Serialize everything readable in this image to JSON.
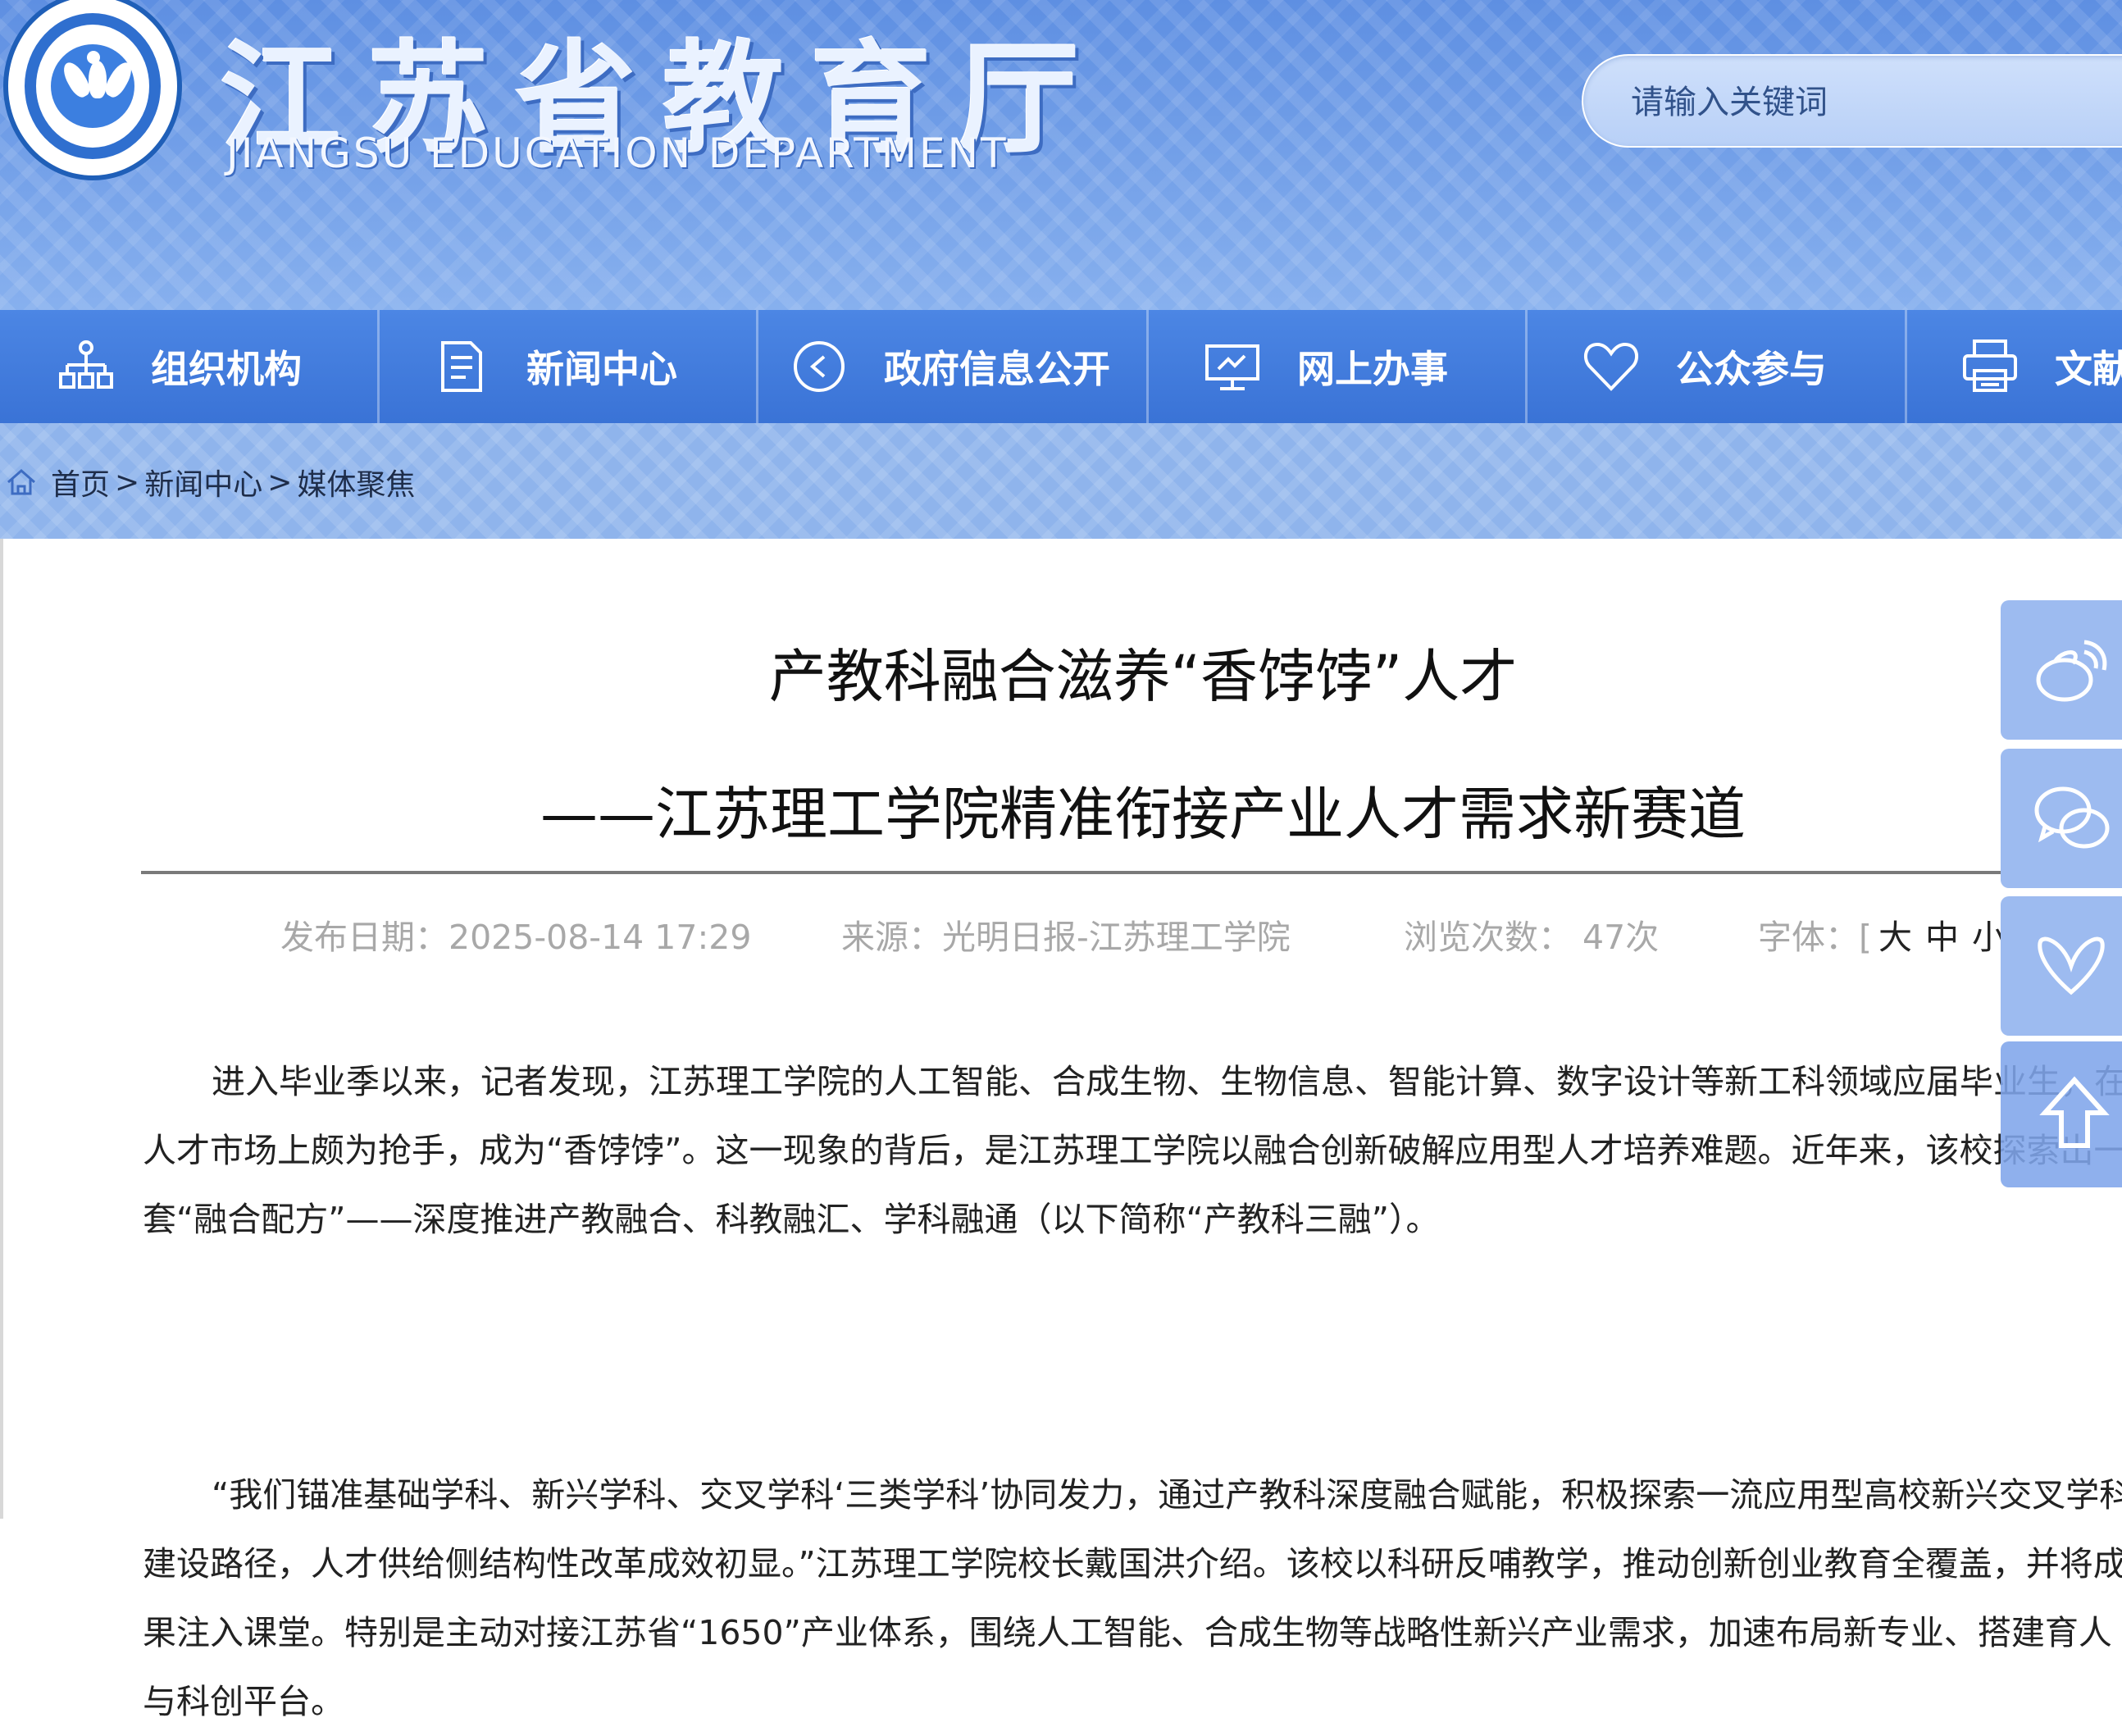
{
  "header": {
    "title": "江苏省教育厅",
    "subtitle": "JIANGSU EDUCATION DEPARTMENT",
    "logo_icon": "seal-logo-icon"
  },
  "search": {
    "placeholder": "请输入关键词"
  },
  "nav": {
    "items": [
      {
        "label": "组织机构",
        "icon": "org-chart-icon"
      },
      {
        "label": "新闻中心",
        "icon": "document-icon"
      },
      {
        "label": "政府信息公开",
        "icon": "play-circle-icon"
      },
      {
        "label": "网上办事",
        "icon": "monitor-icon"
      },
      {
        "label": "公众参与",
        "icon": "heart-icon"
      },
      {
        "label": "文献",
        "icon": "printer-icon"
      }
    ]
  },
  "breadcrumb": {
    "items": [
      "首页",
      "新闻中心",
      "媒体聚焦"
    ],
    "separator": ">"
  },
  "article": {
    "title": "产教科融合滋养“香饽饽”人才",
    "subtitle": "——江苏理工学院精准衔接产业人才需求新赛道",
    "meta": {
      "date_label": "发布日期：",
      "date": "2025-08-14 17:29",
      "source_label": "来源：",
      "source": "光明日报-江苏理工学院",
      "views_label": "浏览次数：",
      "views": "47次",
      "font_label": "字体：",
      "font_open": "[",
      "font_large": "大",
      "font_medium": "中",
      "font_small": "小",
      "font_close": "]"
    },
    "paragraphs": [
      "进入毕业季以来，记者发现，江苏理工学院的人工智能、合成生物、生物信息、智能计算、数字设计等新工科领域应届毕业生，在人才市场上颇为抢手，成为“香饽饽”。这一现象的背后，是江苏理工学院以融合创新破解应用型人才培养难题。近年来，该校探索出一套“融合配方”——深度推进产教融合、科教融汇、学科融通（以下简称“产教科三融”）。",
      "“我们锚准基础学科、新兴学科、交叉学科‘三类学科’协同发力，通过产教科深度融合赋能，积极探索一流应用型高校新兴交叉学科建设路径，人才供给侧结构性改革成效初显。”江苏理工学院校长戴国洪介绍。该校以科研反哺教学，推动创新创业教育全覆盖，并将成果注入课堂。特别是主动对接江苏省“1650”产业体系，围绕人工智能、合成生物等战略性新兴产业需求，加速布局新专业、搭建育人与科创平台。"
    ]
  },
  "share": {
    "items": [
      "weibo-icon",
      "wechat-icon",
      "butterfly-icon"
    ],
    "back_to_top": "arrow-up-icon"
  },
  "colors": {
    "header_blue": "#6b99e4",
    "nav_blue": "#3a73d6",
    "meta_gray": "#a8a8a8",
    "share_blue": "#9dbbf0"
  }
}
